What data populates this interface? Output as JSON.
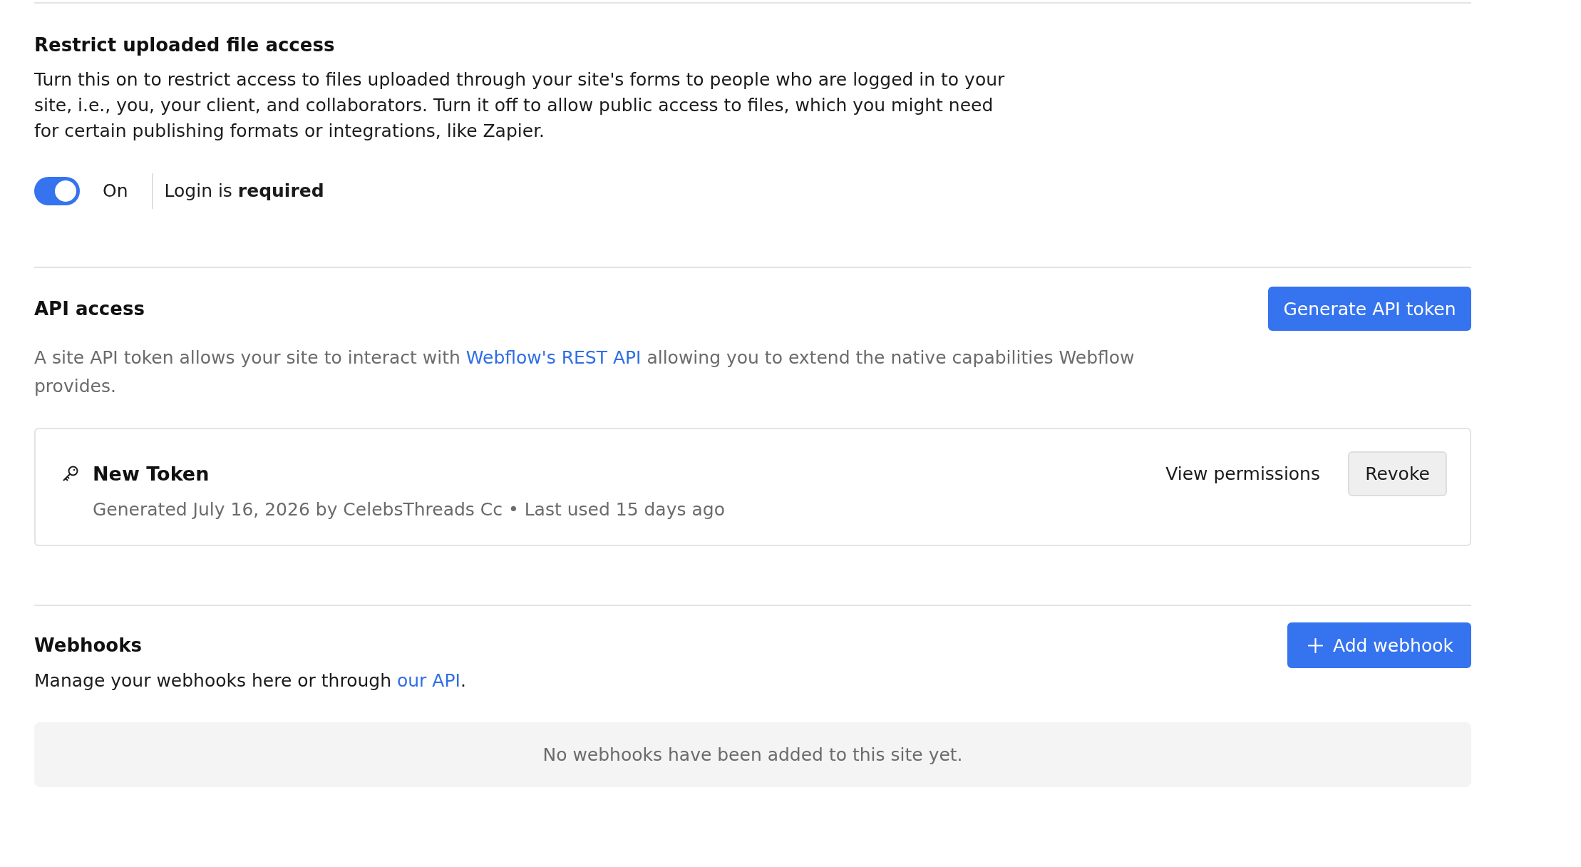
{
  "file_access": {
    "title": "Restrict uploaded file access",
    "description": "Turn this on to restrict access to files uploaded through your site's forms to people who are logged in to your site, i.e., you, your client, and collaborators. Turn it off to allow public access to files, which you might need for certain publishing formats or integrations, like Zapier.",
    "toggle": {
      "on": true,
      "label": "On"
    },
    "status": "Login is **required**"
  },
  "api_access": {
    "title": "API access",
    "generate_button": "Generate API token",
    "description": {
      "before": "A site API token allows your site to interact with ",
      "link": "Webflow's REST API",
      "after": " allowing you to extend the native capabilities Webflow provides."
    },
    "tokens": [
      {
        "name": "New Token",
        "details": "Generated July 16, 2026 by CelebsThreads Cc • Last used 15 days ago",
        "view_button": "View permissions",
        "revoke_button": "Revoke"
      }
    ]
  },
  "webhooks": {
    "title": "Webhooks",
    "add_button": "Add webhook",
    "description": {
      "before": "Manage your webhooks here or through ",
      "link": "our API",
      "after": "."
    },
    "empty_message": "No webhooks have been added to this site yet."
  }
}
